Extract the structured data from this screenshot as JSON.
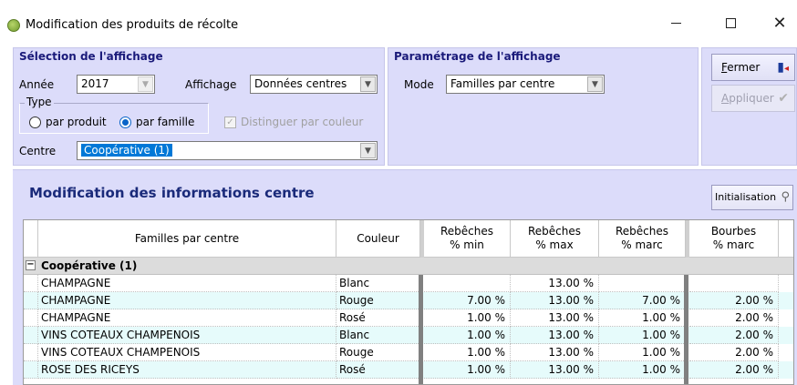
{
  "window": {
    "title": "Modification des produits de récolte",
    "app_icon": "grape-icon",
    "controls": {
      "minimize": "—",
      "maximize": "☐",
      "close": "✕"
    }
  },
  "selection": {
    "legend": "Sélection de l'affichage",
    "annee_label": "Année",
    "annee_value": "2017",
    "affichage_label": "Affichage",
    "affichage_value": "Données centres",
    "type_legend": "Type",
    "radio_produit": "par produit",
    "radio_famille": "par famille",
    "selected_type": "par famille",
    "distinguer_label": "Distinguer par couleur",
    "distinguer_checked": true,
    "centre_label": "Centre",
    "centre_value": "Coopérative (1)"
  },
  "parametrage": {
    "legend": "Paramétrage de l'affichage",
    "mode_label": "Mode",
    "mode_value": "Familles par centre"
  },
  "actions": {
    "fermer_prefix": "F",
    "fermer_rest": "ermer",
    "appliquer_prefix": "A",
    "appliquer_rest": "ppliquer"
  },
  "main": {
    "section_title": "Modification des informations centre",
    "init_button": "Initialisation"
  },
  "grid": {
    "headers": {
      "familles": "Familles par centre",
      "couleur": "Couleur",
      "reb_min_1": "Rebêches",
      "reb_min_2": "% min",
      "reb_max_1": "Rebêches",
      "reb_max_2": "% max",
      "reb_marc_1": "Rebêches",
      "reb_marc_2": "% marc",
      "bourbes_1": "Bourbes",
      "bourbes_2": "% marc"
    },
    "group": {
      "label": "Coopérative (1)",
      "expander": "−"
    },
    "rows": [
      {
        "famille": "CHAMPAGNE",
        "couleur": "Blanc",
        "reb_min": "",
        "reb_max": "13.00 %",
        "reb_marc": "",
        "bourbes": ""
      },
      {
        "famille": "CHAMPAGNE",
        "couleur": "Rouge",
        "reb_min": "7.00 %",
        "reb_max": "13.00 %",
        "reb_marc": "7.00 %",
        "bourbes": "2.00 %"
      },
      {
        "famille": "CHAMPAGNE",
        "couleur": "Rosé",
        "reb_min": "1.00 %",
        "reb_max": "13.00 %",
        "reb_marc": "1.00 %",
        "bourbes": "2.00 %"
      },
      {
        "famille": "VINS COTEAUX CHAMPENOIS",
        "couleur": "Blanc",
        "reb_min": "1.00 %",
        "reb_max": "13.00 %",
        "reb_marc": "1.00 %",
        "bourbes": "2.00 %"
      },
      {
        "famille": "VINS COTEAUX CHAMPENOIS",
        "couleur": "Rouge",
        "reb_min": "1.00 %",
        "reb_max": "13.00 %",
        "reb_marc": "1.00 %",
        "bourbes": "2.00 %"
      },
      {
        "famille": "ROSE DES RICEYS",
        "couleur": "Rosé",
        "reb_min": "1.00 %",
        "reb_max": "13.00 %",
        "reb_marc": "1.00 %",
        "bourbes": "2.00 %"
      }
    ]
  },
  "colors": {
    "panel_bg": "#dcdcfa",
    "legend_text": "#1a1a7a",
    "title_text": "#1a2a7a",
    "row_alt": "#e6fbfb",
    "selection": "#0078d7"
  }
}
